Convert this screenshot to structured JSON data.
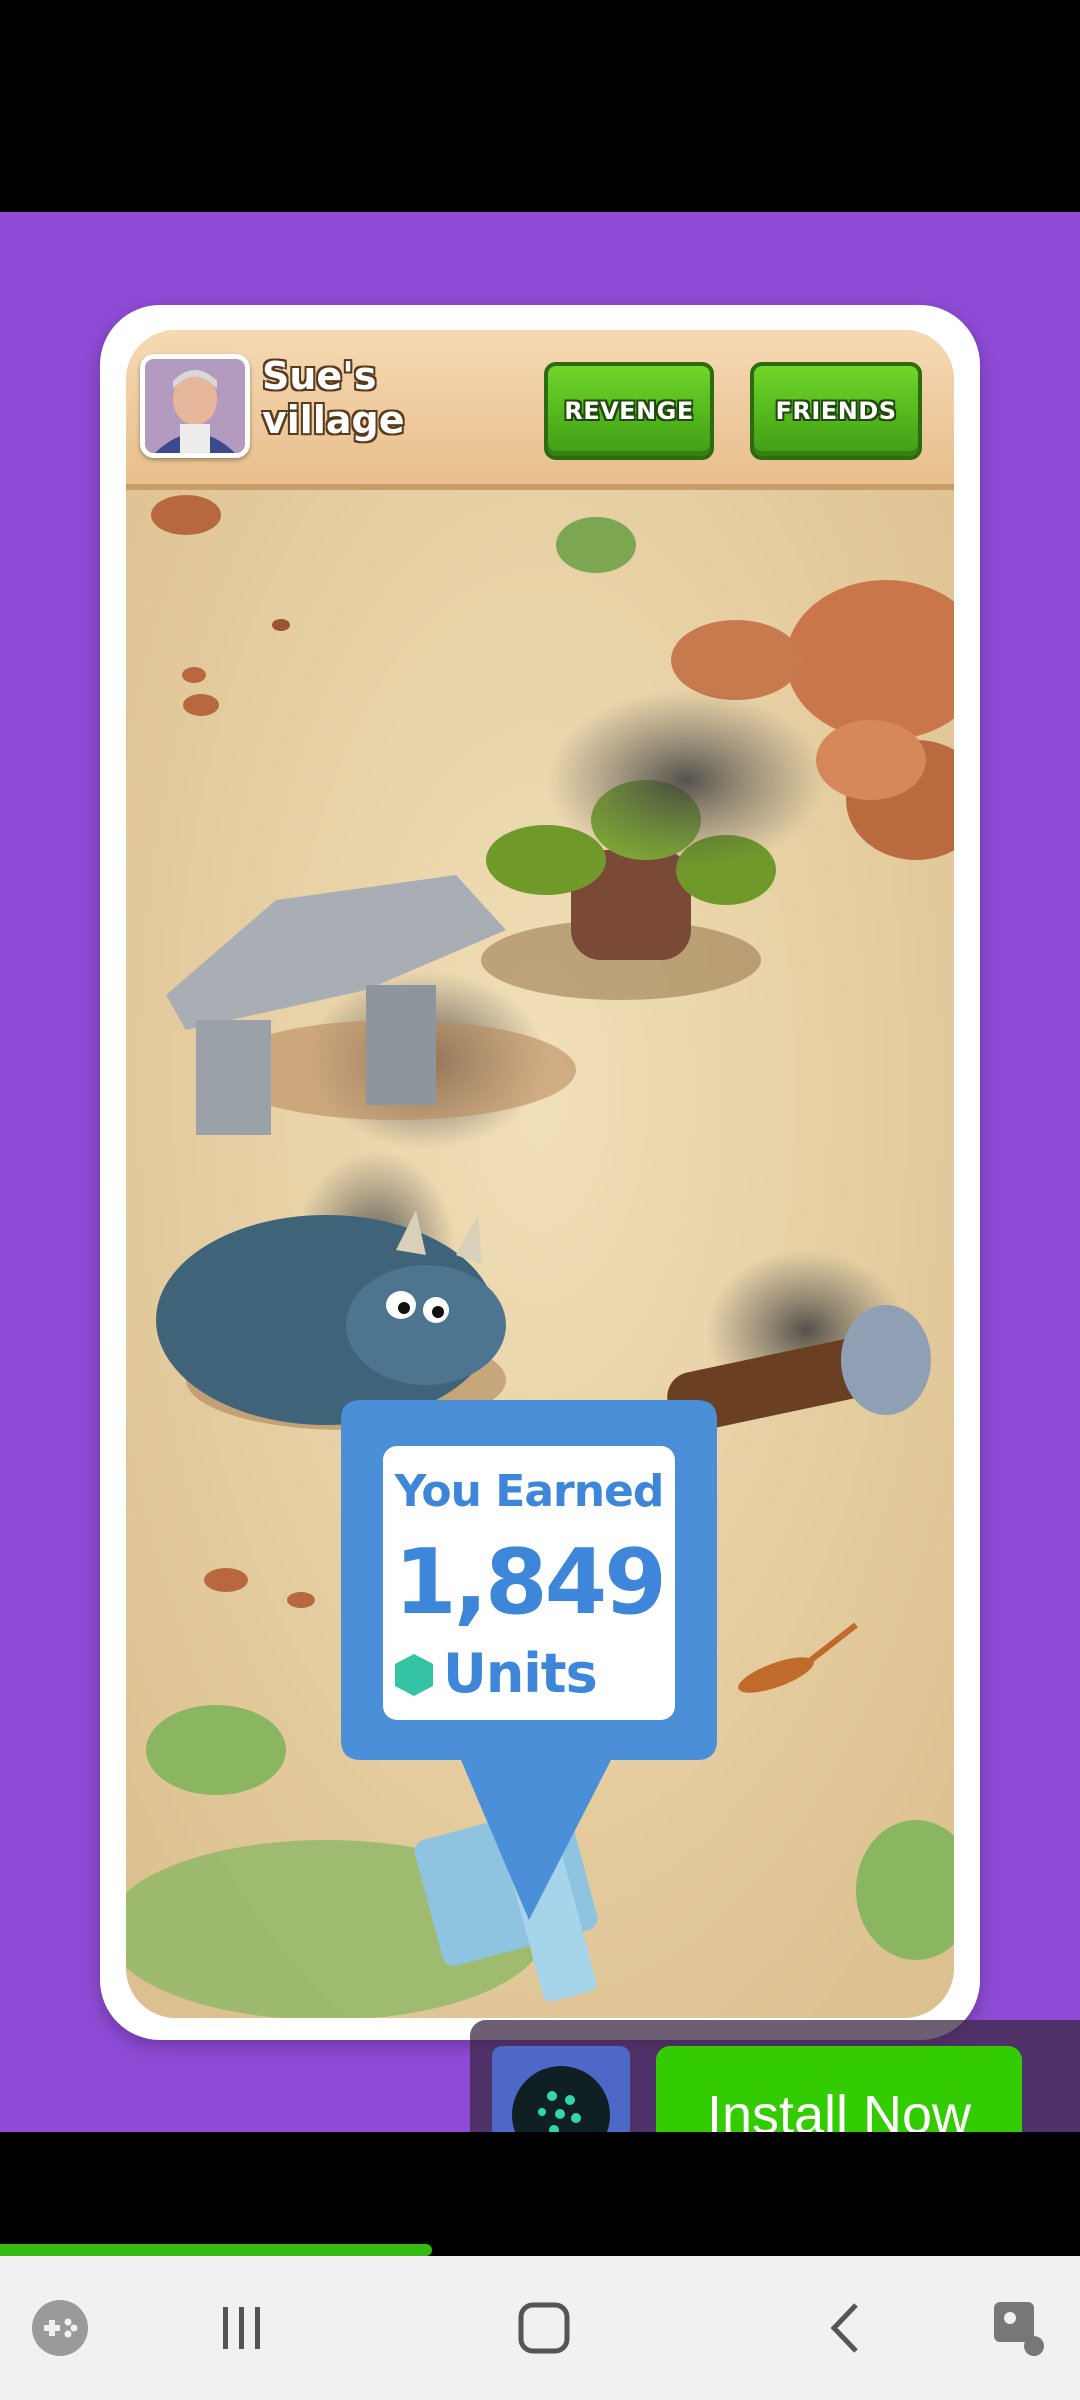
{
  "game": {
    "village_name": "Sue's\nvillage",
    "revenge_label": "REVENGE",
    "friends_label": "FRIENDS"
  },
  "earned": {
    "title": "You Earned",
    "value": "1,849",
    "units_label": "Units"
  },
  "ad": {
    "install_label": "Install Now",
    "progress_fraction": 0.4
  },
  "colors": {
    "purple_background": "#8f4bd6",
    "install_green": "#33cc00",
    "earned_blue": "#3e86d9"
  },
  "nav": {
    "icons": [
      "game-launcher-icon",
      "recent-apps-icon",
      "home-icon",
      "back-icon",
      "screen-assist-icon"
    ]
  }
}
